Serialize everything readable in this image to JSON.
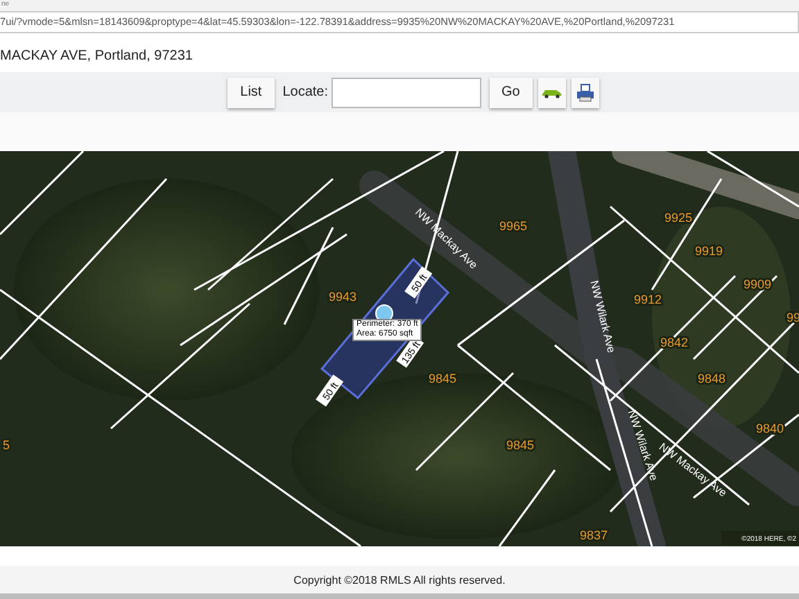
{
  "browser": {
    "tab_fragment": "ne",
    "url": "7ui/?vmode=5&mlsn=18143609&proptype=4&lat=45.59303&lon=-122.78391&address=9935%20NW%20MACKAY%20AVE,%20Portland,%2097231"
  },
  "address": "MACKAY AVE, Portland, 97231",
  "toolbar": {
    "list_button": "List",
    "locate_label": "Locate:",
    "go_button": "Go"
  },
  "map": {
    "streets": [
      "NW Mackay Ave",
      "NW Wilark Ave",
      "NW Wilark Ave",
      "NW Mackay Ave"
    ],
    "parcels": [
      "9965",
      "9943",
      "9845",
      "9845",
      "9925",
      "9919",
      "9909",
      "99",
      "9912",
      "9842",
      "9848",
      "9840",
      "9837",
      "5"
    ],
    "measure": {
      "perimeter": "Perimeter: 370 ft",
      "area": "Area: 6750 sqft",
      "sides": [
        "50 ft",
        "135 ft",
        "50 ft"
      ]
    },
    "attribution": "©2018 HERE, ©2"
  },
  "footer": {
    "copyright": "Copyright ©2018 RMLS All rights reserved."
  }
}
